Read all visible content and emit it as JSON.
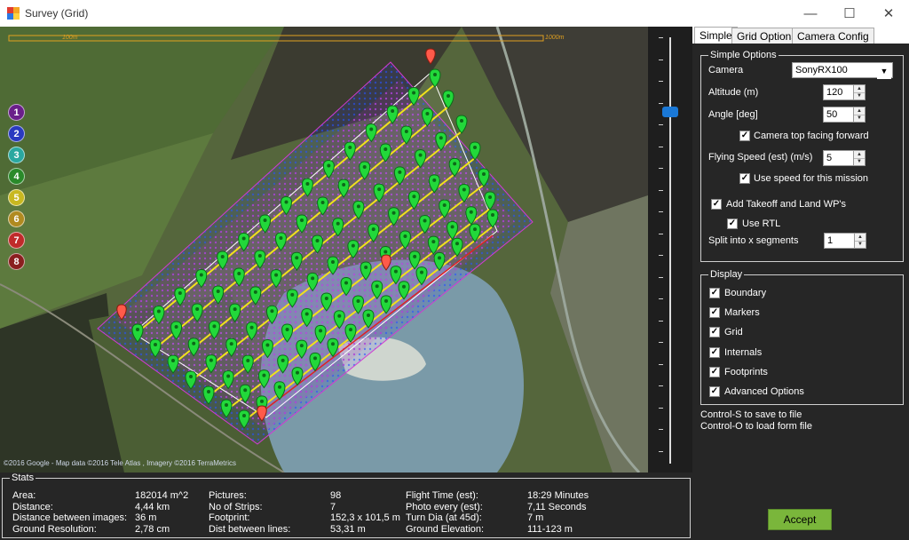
{
  "window": {
    "title": "Survey (Grid)",
    "minimize": "—",
    "maximize": "☐",
    "close": "✕"
  },
  "map": {
    "scale_left": "100m",
    "scale_right": "1000m",
    "attribution": "©2016 Google - Map data ©2016 Tele Atlas , Imagery ©2016 TerraMetrics",
    "layers": [
      {
        "num": "1",
        "color": "#6a1f8a"
      },
      {
        "num": "2",
        "color": "#2a3ac0"
      },
      {
        "num": "3",
        "color": "#2aa8a0"
      },
      {
        "num": "4",
        "color": "#2a8a2a"
      },
      {
        "num": "5",
        "color": "#c8b820"
      },
      {
        "num": "6",
        "color": "#b08a20"
      },
      {
        "num": "7",
        "color": "#c02a2a"
      },
      {
        "num": "8",
        "color": "#8a1f1f"
      }
    ]
  },
  "tabs": [
    "Simple",
    "Grid Options",
    "Camera Config"
  ],
  "simple": {
    "group_title": "Simple Options",
    "camera_label": "Camera",
    "camera_value": "SonyRX100",
    "altitude_label": "Altitude (m)",
    "altitude_value": "120",
    "angle_label": "Angle [deg]",
    "angle_value": "50",
    "camera_top_label": "Camera top facing forward",
    "speed_label": "Flying Speed (est) (m/s)",
    "speed_value": "5",
    "use_speed_label": "Use speed for this mission",
    "takeoff_label": "Add Takeoff and Land WP's",
    "rtl_label": "Use RTL",
    "split_label": "Split into x segments",
    "split_value": "1"
  },
  "display": {
    "group_title": "Display",
    "items": [
      "Boundary",
      "Markers",
      "Grid",
      "Internals",
      "Footprints",
      "Advanced Options"
    ]
  },
  "hints": {
    "save": "Control-S to save to file",
    "load": "Control-O to load form file"
  },
  "accept_label": "Accept",
  "stats": {
    "title": "Stats",
    "col1": [
      {
        "k": "Area:",
        "v": "182014 m^2"
      },
      {
        "k": "Distance:",
        "v": "4,44 km"
      },
      {
        "k": "Distance between images:",
        "v": "36 m"
      },
      {
        "k": "Ground Resolution:",
        "v": "2,78 cm"
      }
    ],
    "col2": [
      {
        "k": "Pictures:",
        "v": "98"
      },
      {
        "k": "No of Strips:",
        "v": "7"
      },
      {
        "k": "Footprint:",
        "v": "152,3 x 101,5 m"
      },
      {
        "k": "Dist between lines:",
        "v": "53,31 m"
      }
    ],
    "col3": [
      {
        "k": "Flight Time (est):",
        "v": "18:29 Minutes"
      },
      {
        "k": "Photo every (est):",
        "v": "7,11 Seconds"
      },
      {
        "k": "Turn Dia (at 45d):",
        "v": "7 m"
      },
      {
        "k": "Ground Elevation:",
        "v": "111-123 m"
      }
    ]
  }
}
